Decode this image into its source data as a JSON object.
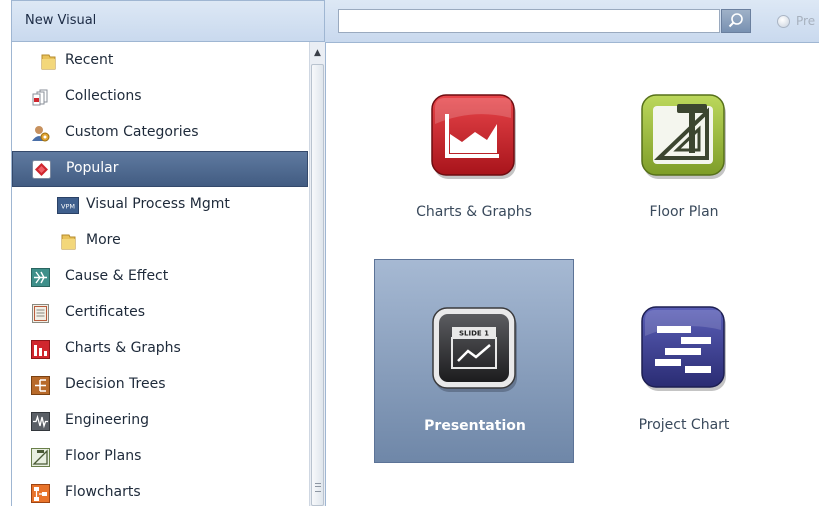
{
  "panel": {
    "title": "New Visual"
  },
  "nav": {
    "items": [
      {
        "label": "Recent",
        "icon": "folder-icon"
      },
      {
        "label": "Collections",
        "icon": "collections-icon"
      },
      {
        "label": "Custom Categories",
        "icon": "custom-categories-icon"
      },
      {
        "label": "Popular",
        "icon": "popular-icon",
        "selected": true
      },
      {
        "label": "Visual Process Mgmt",
        "icon": "vpm-icon",
        "badge": "VPM"
      },
      {
        "label": "More",
        "icon": "folder-icon"
      },
      {
        "label": "Cause & Effect",
        "icon": "cause-effect-icon"
      },
      {
        "label": "Certificates",
        "icon": "certificate-icon"
      },
      {
        "label": "Charts & Graphs",
        "icon": "charts-graphs-icon"
      },
      {
        "label": "Decision Trees",
        "icon": "decision-tree-icon"
      },
      {
        "label": "Engineering",
        "icon": "engineering-icon"
      },
      {
        "label": "Floor Plans",
        "icon": "floor-plans-icon"
      },
      {
        "label": "Flowcharts",
        "icon": "flowchart-icon"
      }
    ]
  },
  "search": {
    "value": "",
    "placeholder": ""
  },
  "preview": {
    "label": "Pre"
  },
  "tiles": [
    {
      "label": "Charts & Graphs",
      "icon": "charts-graphs-icon"
    },
    {
      "label": "Floor Plan",
      "icon": "floor-plan-icon"
    },
    {
      "label": "Presentation",
      "icon": "presentation-icon",
      "selected": true,
      "slide_text": "SLIDE 1"
    },
    {
      "label": "Project Chart",
      "icon": "project-chart-icon"
    }
  ],
  "colors": {
    "selection": "#4f6b92",
    "header": "#c9d9ee",
    "charts_icon": "#c9222a",
    "floorplan_icon": "#8fb33c",
    "project_icon": "#3b3d8f",
    "presentation_icon": "#3d3d40"
  }
}
